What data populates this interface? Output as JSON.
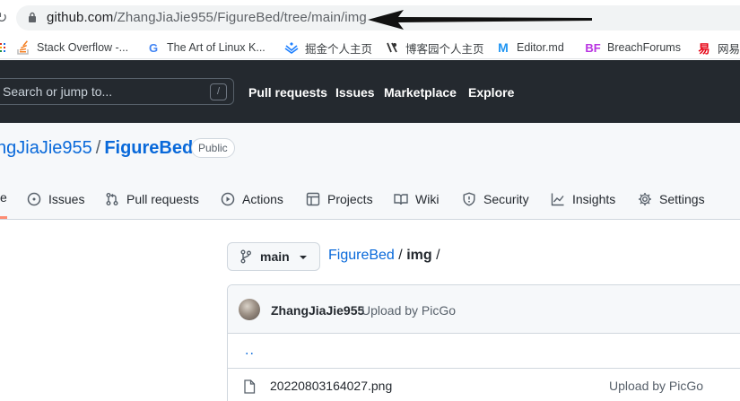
{
  "browser": {
    "url_host": "github.com",
    "url_path": "/ZhangJiaJie955/FigureBed/tree/main/img",
    "bookmarks": [
      {
        "label": "Stack Overflow -...",
        "icon": "stackoverflow-icon"
      },
      {
        "label": "The Art of Linux K...",
        "icon": "google-icon"
      },
      {
        "label": "掘金个人主页",
        "icon": "juejin-icon"
      },
      {
        "label": "博客园个人主页",
        "icon": "cnblogs-icon"
      },
      {
        "label": "Editor.md",
        "icon": "editormd-icon"
      },
      {
        "label": "BreachForums",
        "icon": "bf-icon"
      },
      {
        "label": "网易",
        "icon": "netease-icon"
      }
    ]
  },
  "header": {
    "search_placeholder": "Search or jump to...",
    "search_shortcut": "/",
    "nav": [
      "Pull requests",
      "Issues",
      "Marketplace",
      "Explore"
    ]
  },
  "repo": {
    "owner": "ngJiaJie955",
    "separator": "/",
    "name": "FigureBed",
    "visibility": "Public",
    "tab_fragment": "e",
    "tabs": [
      {
        "label": "Issues",
        "icon": "issue-icon"
      },
      {
        "label": "Pull requests",
        "icon": "pull-request-icon"
      },
      {
        "label": "Actions",
        "icon": "actions-icon"
      },
      {
        "label": "Projects",
        "icon": "projects-icon"
      },
      {
        "label": "Wiki",
        "icon": "wiki-icon"
      },
      {
        "label": "Security",
        "icon": "security-icon"
      },
      {
        "label": "Insights",
        "icon": "insights-icon"
      },
      {
        "label": "Settings",
        "icon": "settings-icon"
      }
    ]
  },
  "files": {
    "branch": "main",
    "breadcrumb_repo": "FigureBed",
    "breadcrumb_sep1": "/",
    "breadcrumb_dir": "img",
    "breadcrumb_sep2": "/",
    "commit_author": "ZhangJiaJie955",
    "commit_message": "Upload by PicGo",
    "parent_link": "..",
    "rows": [
      {
        "name": "20220803164027.png",
        "commit": "Upload by PicGo"
      }
    ]
  },
  "colors": {
    "header_bg": "#24292f",
    "link": "#0969da",
    "tab_underline": "#fd8c73"
  }
}
